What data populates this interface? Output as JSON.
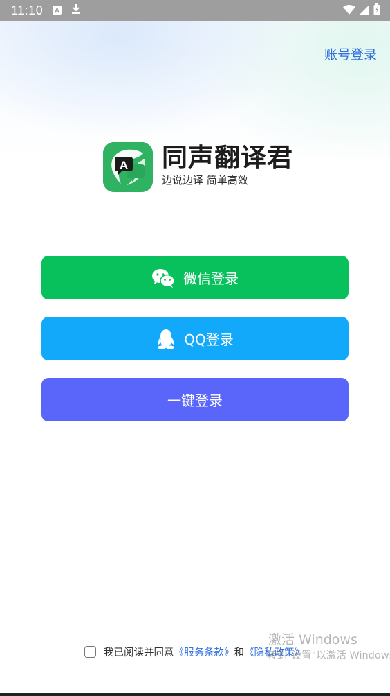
{
  "status_bar": {
    "time": "11:10",
    "icons": [
      "a-notification-icon",
      "download-icon",
      "wifi-icon",
      "signal-icon",
      "battery-icon"
    ]
  },
  "header": {
    "account_login_label": "账号登录"
  },
  "app": {
    "name": "同声翻译君",
    "slogan": "边说边译 简单高效",
    "logo_icon": "translate-chat-icon",
    "logo_letter": "A",
    "logo_color": "#2fb262"
  },
  "buttons": {
    "wechat": {
      "label": "微信登录",
      "icon": "wechat-icon",
      "color": "#08c15d"
    },
    "qq": {
      "label": "QQ登录",
      "icon": "qq-penguin-icon",
      "color": "#12a9fb"
    },
    "onekey": {
      "label": "一键登录",
      "color": "#5a66fa"
    }
  },
  "agreement": {
    "checked": false,
    "prefix": "我已阅读并同意",
    "terms_link": "《服务条款》",
    "conjunction": "和",
    "privacy_link": "《隐私政策》"
  },
  "watermark": {
    "title": "激活 Windows",
    "subtitle": "转到\"设置\"以激活 Windows。"
  }
}
